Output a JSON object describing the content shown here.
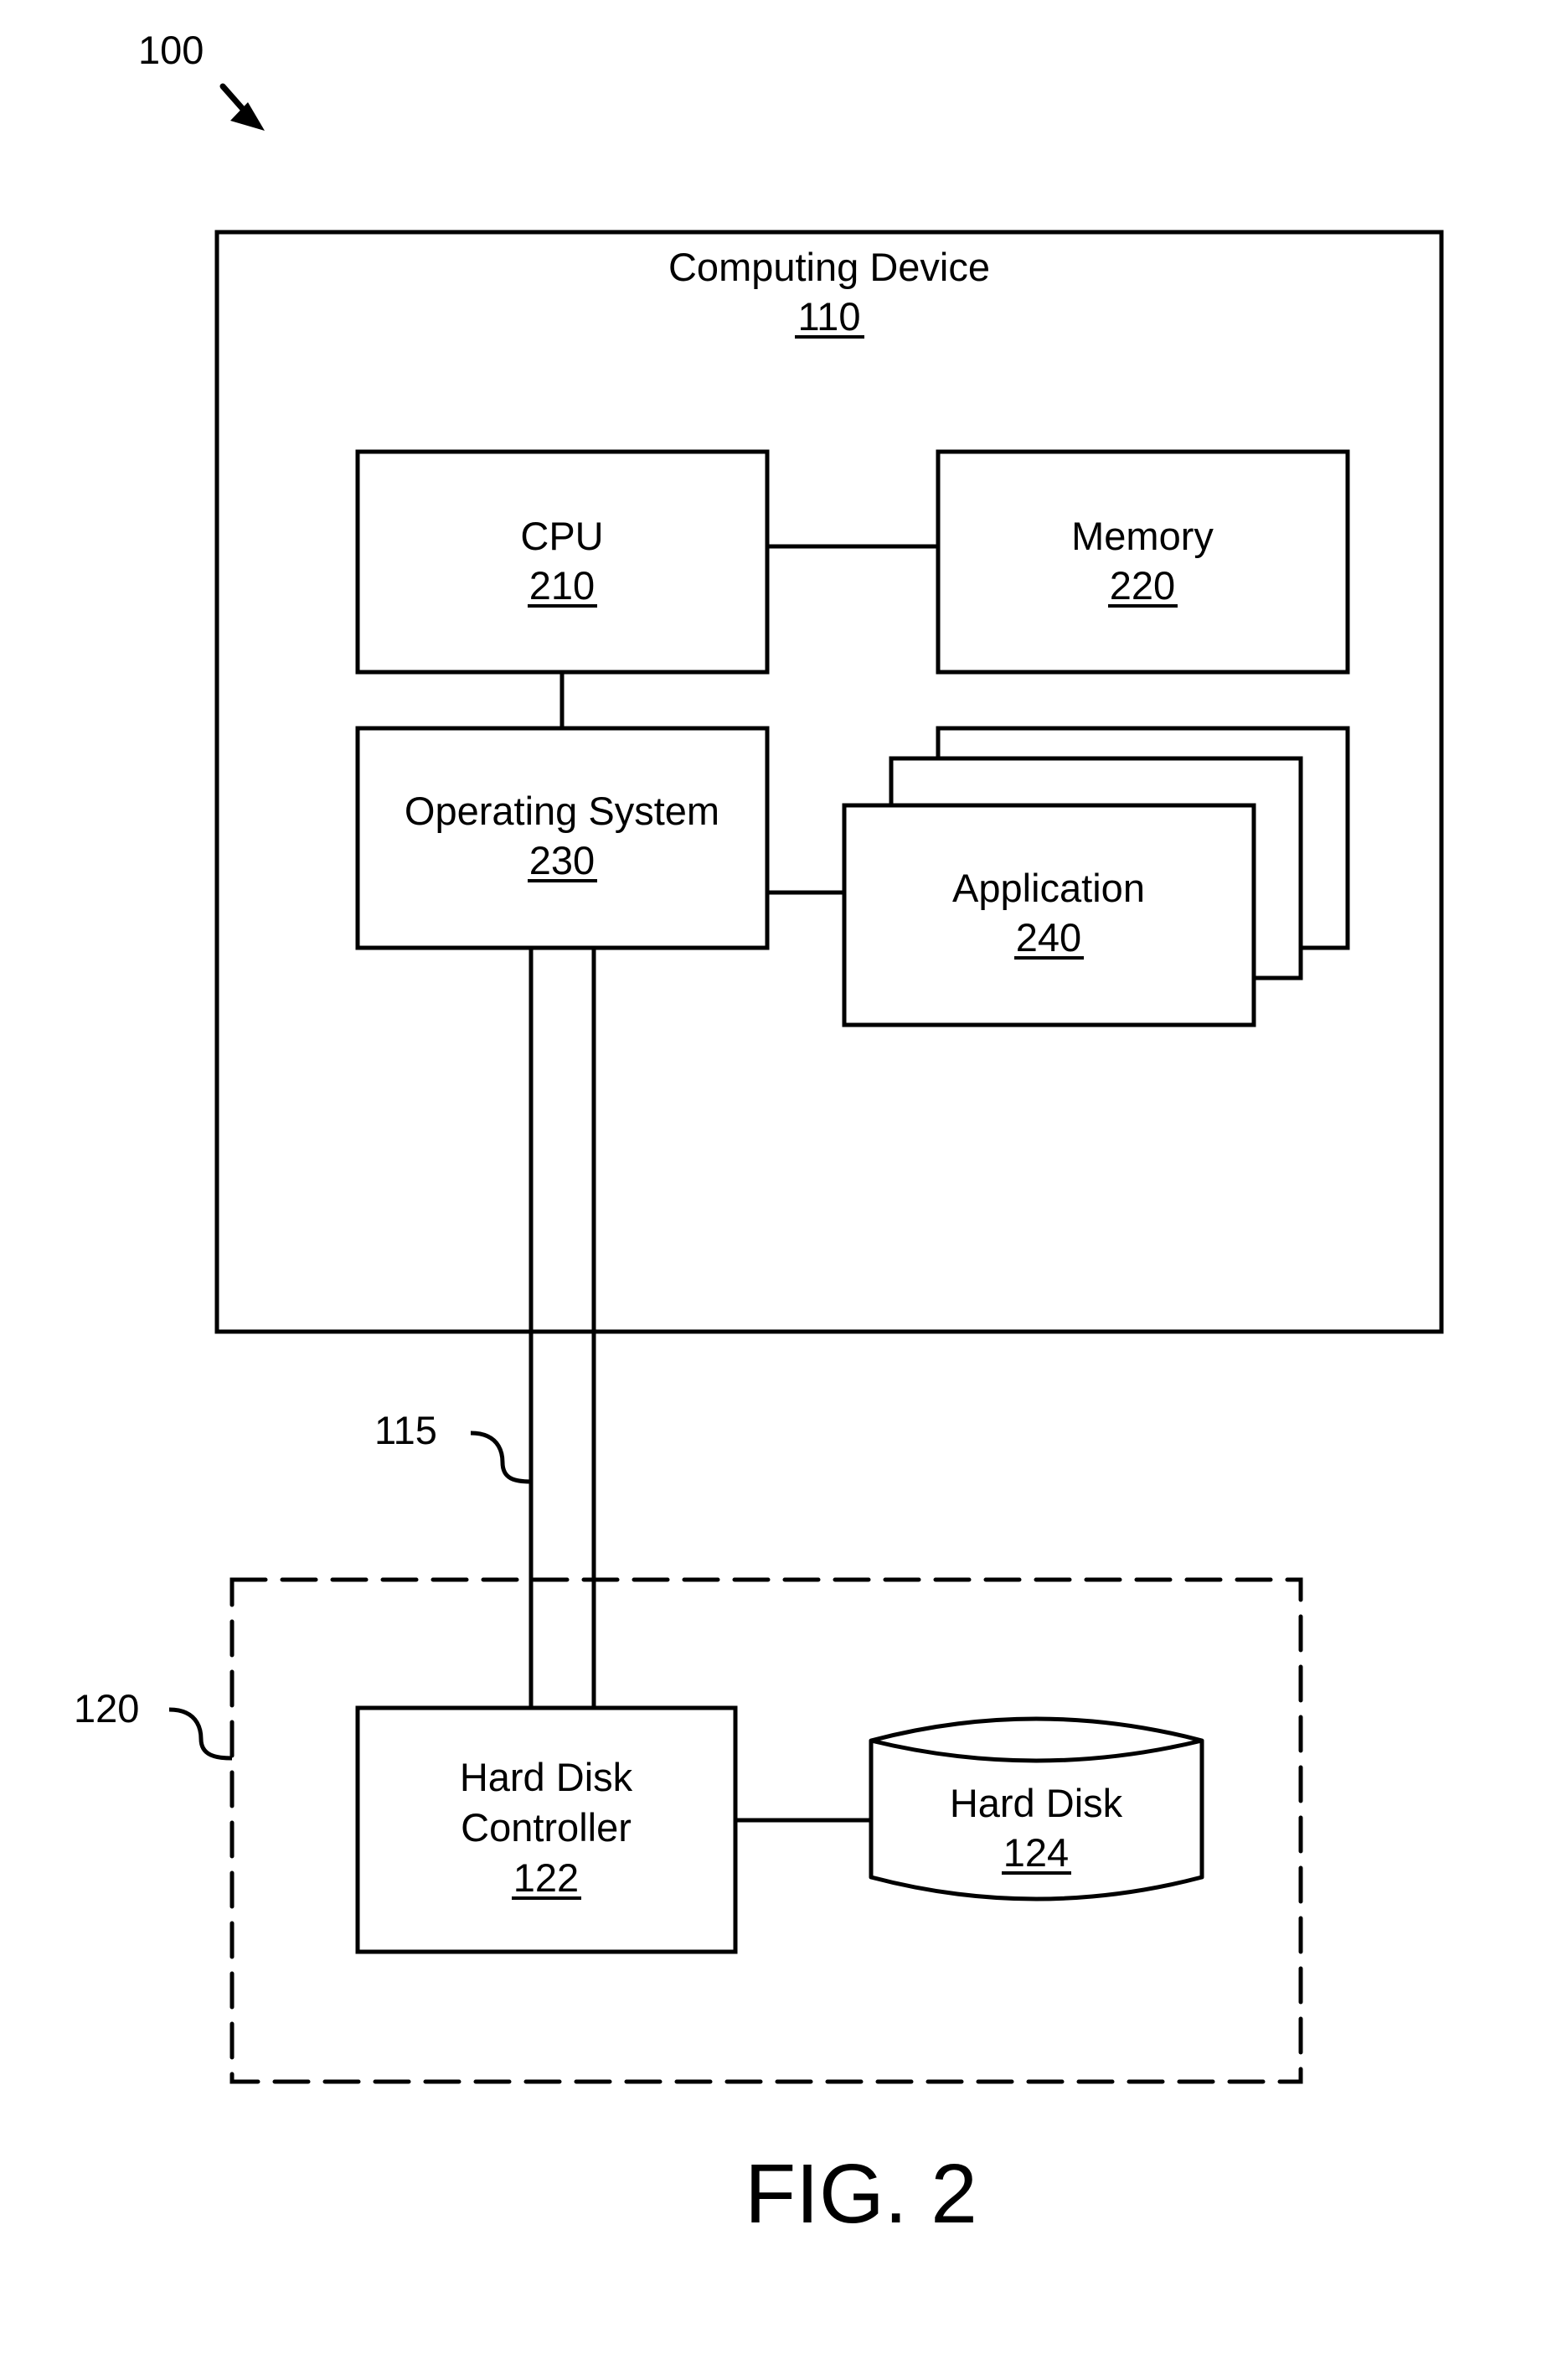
{
  "figure": {
    "reference_number": "100",
    "caption": "FIG. 2"
  },
  "computing_device": {
    "label": "Computing Device",
    "ref": "110"
  },
  "cpu": {
    "label": "CPU",
    "ref": "210"
  },
  "memory": {
    "label": "Memory",
    "ref": "220"
  },
  "operating_system": {
    "label": "Operating System",
    "ref": "230"
  },
  "application": {
    "label": "Application",
    "ref": "240"
  },
  "bus": {
    "ref": "115"
  },
  "storage_subsystem": {
    "ref": "120"
  },
  "hard_disk_controller": {
    "label_line1": "Hard Disk",
    "label_line2": "Controller",
    "ref": "122"
  },
  "hard_disk": {
    "label": "Hard Disk",
    "ref": "124"
  },
  "colors": {
    "stroke": "#000000",
    "background": "#ffffff"
  }
}
